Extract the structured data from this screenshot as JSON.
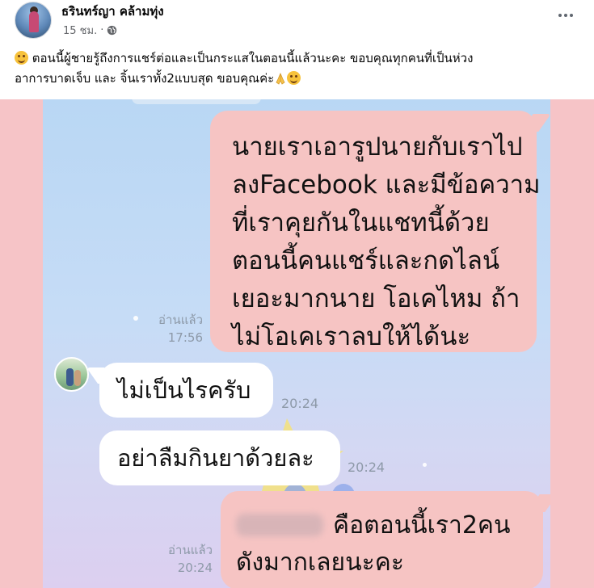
{
  "post": {
    "author": "ธรินทร์ญา คล้ามทุ่ง",
    "time": "15 ชม.",
    "separator": "·",
    "caption_part1": " ตอนนี้ผู้ชายรู้ถึงการแชร์ต่อและเป็นกระแสในตอนนี้แล้วนะคะ ขอบคุณทุกคนที่เป็นห่วง",
    "caption_part2": "อาการบาดเจ็บ และ จิ้นเราทั้ง2แบบสุด ขอบคุณค่ะ",
    "icons": {
      "privacy": "globe-icon",
      "options": "more-options-icon",
      "emoji_start": "smiling-face-emoji",
      "emoji_pray": "folded-hands-emoji",
      "emoji_end": "smiling-face-emoji"
    }
  },
  "chat": {
    "messages": [
      {
        "sender": "self",
        "lines": [
          "นายเราเอารูปนายกับเราไป",
          "ลงFacebook และมีข้อความ",
          "ที่เราคุยกันในแชทนี้ด้วย",
          "ตอนนี้คนแชร์และกดไลน์",
          "เยอะมากนาย โอเคไหม ถ้า",
          "ไม่โอเคเราลบให้ได้นะ"
        ],
        "read_label": "อ่านแล้ว",
        "time": "17:56"
      },
      {
        "sender": "other",
        "text": "ไม่เป็นไรครับ",
        "time": "20:24"
      },
      {
        "sender": "other",
        "text": "อย่าลืมกินยาด้วยละ",
        "time": "20:24"
      },
      {
        "sender": "self",
        "lines": [
          "คือตอนนี้เรา2คน",
          "ดังมากเลยนะคะ"
        ],
        "read_label": "อ่านแล้ว",
        "time": "20:24"
      }
    ]
  },
  "colors": {
    "own_bubble": "#f6c4c3",
    "other_bubble": "#ffffff",
    "photo_border": "#f6c4c7",
    "chat_background": "#c6dcf6",
    "timestamp": "#8d99a8",
    "meta_text": "#65676b"
  }
}
